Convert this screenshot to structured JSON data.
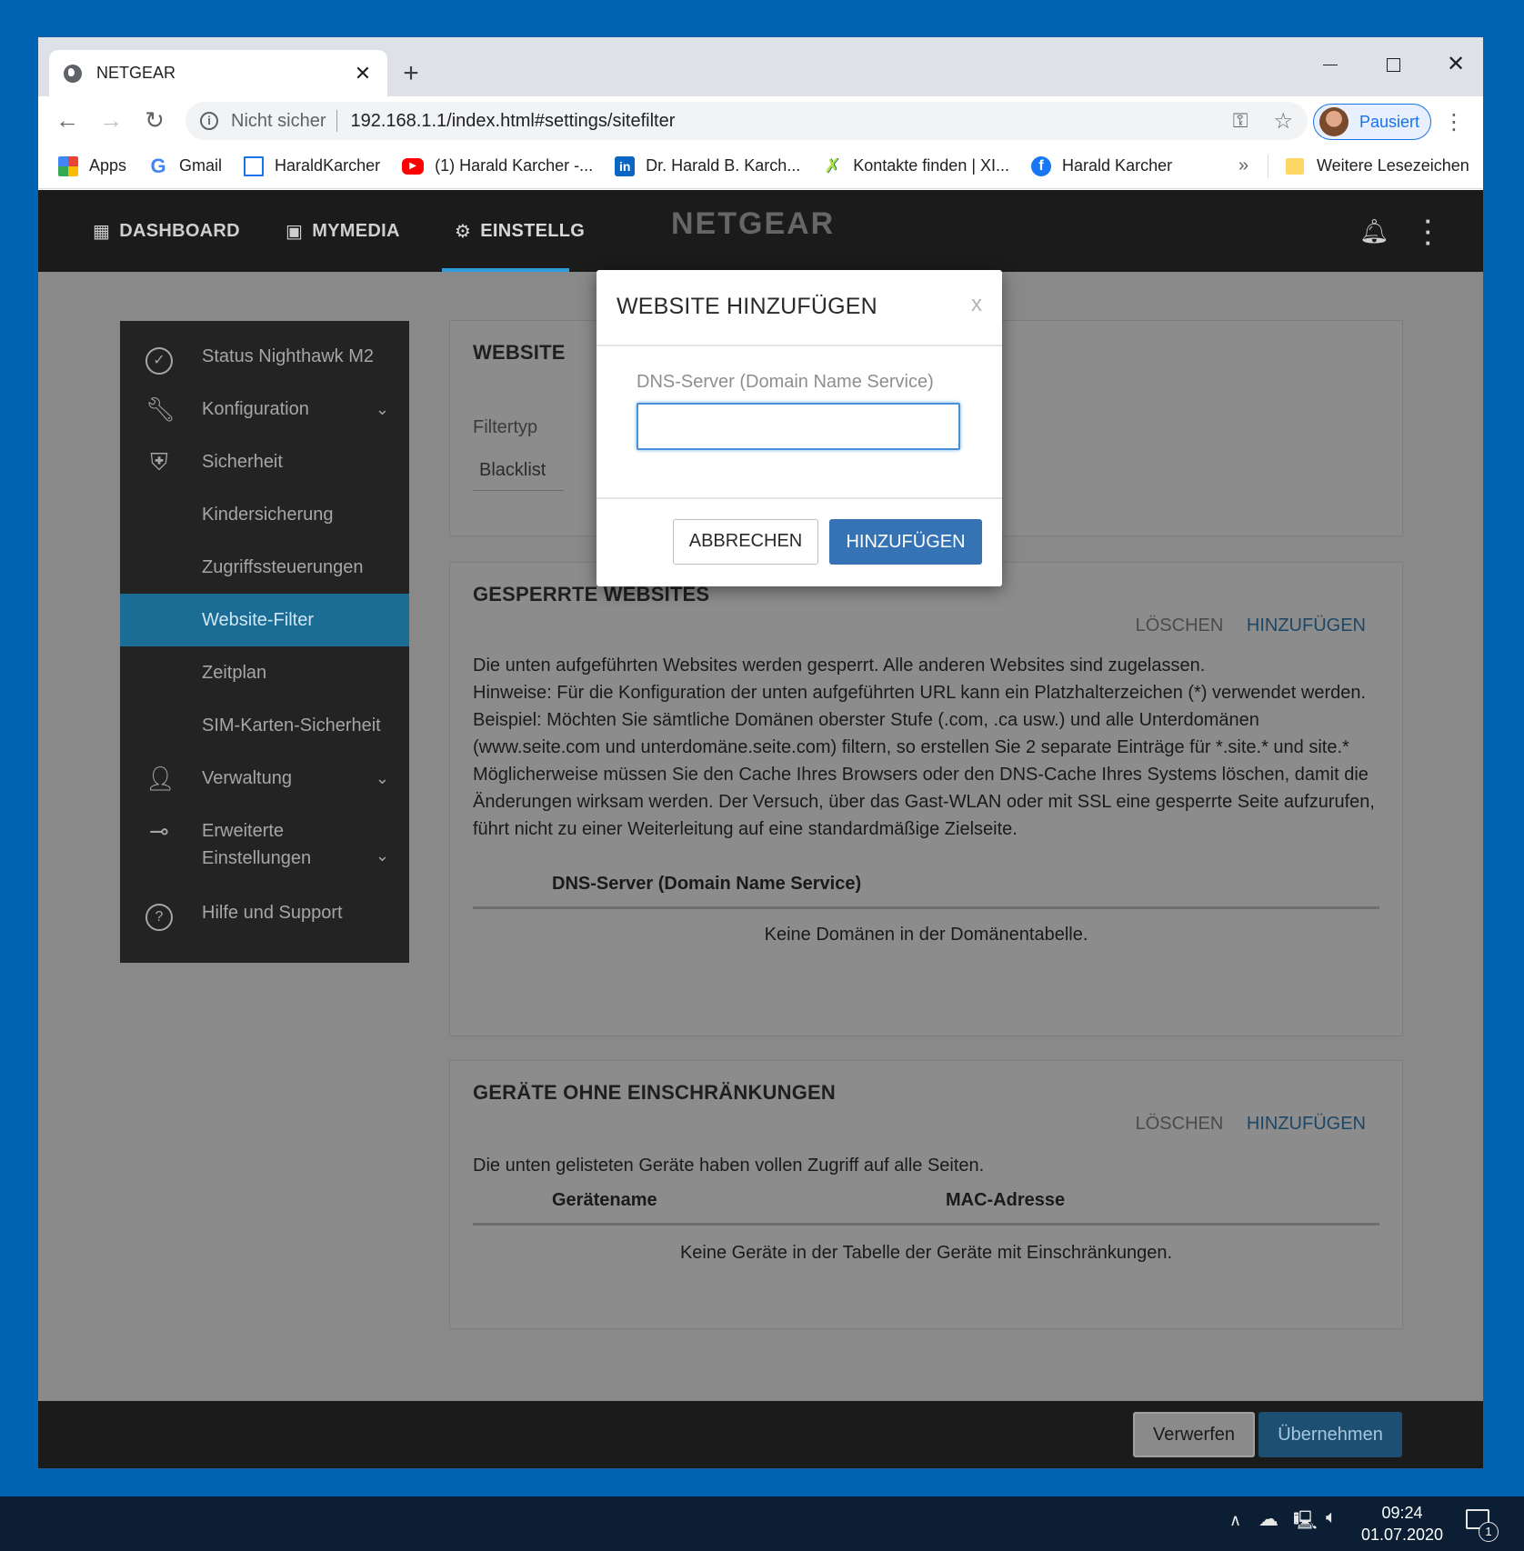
{
  "browser": {
    "tab_title": "NETGEAR",
    "tab_close": "✕",
    "new_tab": "+",
    "security_label": "Nicht sicher",
    "url": "192.168.1.1/index.html#settings/sitefilter",
    "profile_label": "Pausiert",
    "bookmarks": [
      {
        "label": "Apps",
        "icon": "apps-grid-icon"
      },
      {
        "label": "Gmail",
        "icon": "google-icon"
      },
      {
        "label": "HaraldKarcher",
        "icon": "site-icon"
      },
      {
        "label": "(1) Harald Karcher -...",
        "icon": "youtube-icon"
      },
      {
        "label": "Dr. Harald B. Karch...",
        "icon": "linkedin-icon"
      },
      {
        "label": "Kontakte finden | XI...",
        "icon": "xing-icon"
      },
      {
        "label": "Harald Karcher",
        "icon": "facebook-icon"
      }
    ],
    "bookmarks_more": "»",
    "other_bookmarks": "Weitere Lesezeichen"
  },
  "app": {
    "nav": {
      "dashboard": "DASHBOARD",
      "mymedia": "MYMEDIA",
      "settings": "EINSTELLG",
      "logo": "NETGEAR"
    },
    "sidebar": {
      "items": [
        {
          "label": "Status Nighthawk M2"
        },
        {
          "label": "Konfiguration"
        },
        {
          "label": "Sicherheit"
        },
        {
          "label": "Kindersicherung"
        },
        {
          "label": "Zugriffssteuerungen"
        },
        {
          "label": "Website-Filter"
        },
        {
          "label": "Zeitplan"
        },
        {
          "label": "SIM-Karten-Sicherheit"
        },
        {
          "label": "Verwaltung"
        },
        {
          "label": "Erweiterte",
          "label2": "Einstellungen"
        },
        {
          "label": "Hilfe und Support"
        }
      ]
    },
    "website_filter": {
      "title": "WEBSITE",
      "filtertype_label": "Filtertyp",
      "filtertype_value": "Blacklist"
    },
    "blocked_sites": {
      "title": "GESPERRTE WEBSITES",
      "delete": "LÖSCHEN",
      "add": "HINZUFÜGEN",
      "description": [
        "Die unten aufgeführten Websites werden gesperrt. Alle anderen Websites sind zugelassen.",
        "Hinweise: Für die Konfiguration der unten aufgeführten URL kann ein Platzhalterzeichen (*) verwendet werden. Beispiel: Möchten Sie sämtliche Domänen oberster Stufe (.com, .ca usw.) und alle Unterdomänen (www.seite.com und unterdomäne.seite.com) filtern, so erstellen Sie 2 separate Einträge für *.site.* und site.*",
        "Möglicherweise müssen Sie den Cache Ihres Browsers oder den DNS-Cache Ihres Systems löschen, damit die Änderungen wirksam werden. Der Versuch, über das Gast-WLAN oder mit SSL eine gesperrte Seite aufzurufen, führt nicht zu einer Weiterleitung auf eine standardmäßige Zielseite."
      ],
      "column": "DNS-Server (Domain Name Service)",
      "empty": "Keine Domänen in der Domänentabelle."
    },
    "unrestricted_devices": {
      "title": "GERÄTE OHNE EINSCHRÄNKUNGEN",
      "delete": "LÖSCHEN",
      "add": "HINZUFÜGEN",
      "description": "Die unten gelisteten Geräte haben vollen Zugriff auf alle Seiten.",
      "columns": [
        "Gerätename",
        "MAC-Adresse"
      ],
      "empty": "Keine Geräte in der Tabelle der Geräte mit Einschränkungen."
    },
    "footer": {
      "discard": "Verwerfen",
      "apply": "Übernehmen"
    },
    "modal": {
      "title": "WEBSITE HINZUFÜGEN",
      "close": "x",
      "field_label": "DNS-Server (Domain Name Service)",
      "field_value": "",
      "cancel": "ABBRECHEN",
      "add": "HINZUFÜGEN"
    }
  },
  "taskbar": {
    "time": "09:24",
    "date": "01.07.2020",
    "notifications": "1"
  },
  "colors": {
    "accent": "#2e9cd9",
    "sidebar_active": "#1b6d96",
    "primary_button": "#3573b5",
    "desktop": "#0063b1"
  }
}
